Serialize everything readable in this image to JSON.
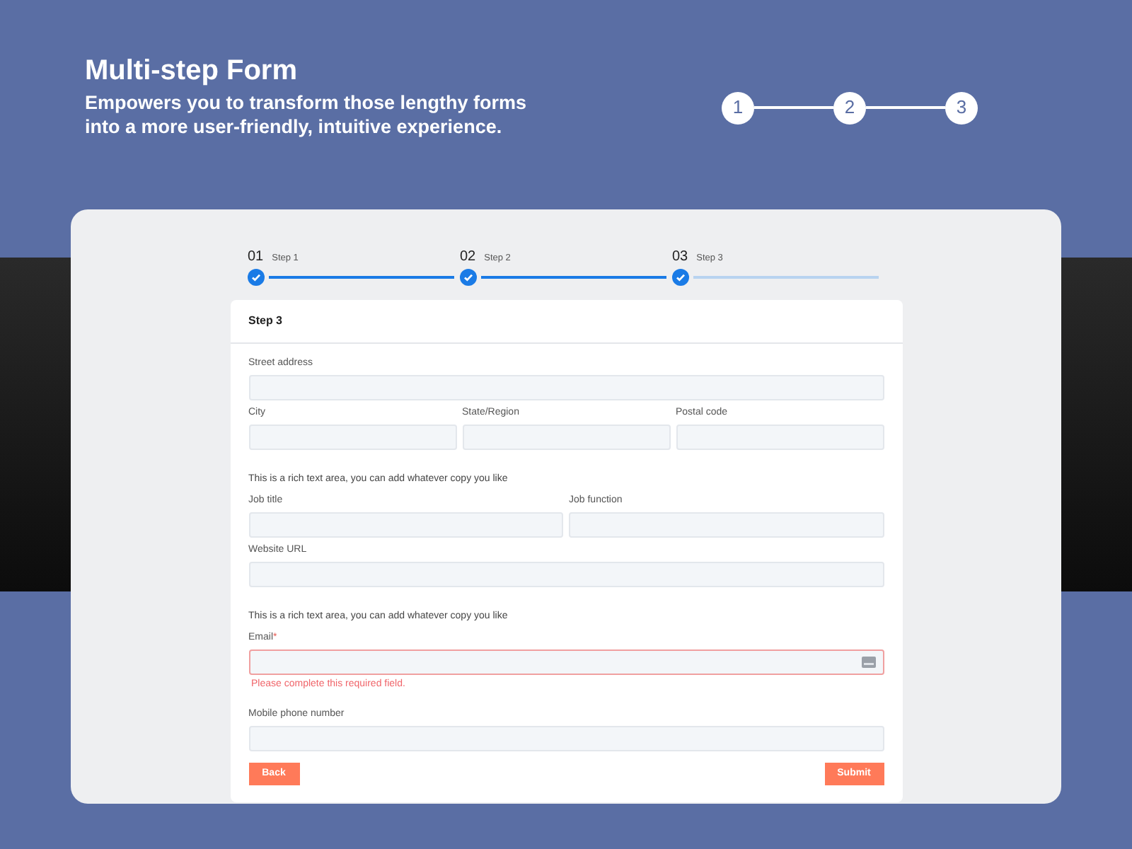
{
  "header": {
    "title": "Multi-step Form",
    "subtitle": "Empowers you to transform those lengthy forms into a more user-friendly, intuitive experience."
  },
  "mini_steps": [
    "1",
    "2",
    "3"
  ],
  "steps": [
    {
      "number": "01",
      "label": "Step 1",
      "completed": true,
      "line_done": true
    },
    {
      "number": "02",
      "label": "Step 2",
      "completed": true,
      "line_done": true
    },
    {
      "number": "03",
      "label": "Step 3",
      "completed": true,
      "line_done": false
    }
  ],
  "form": {
    "title": "Step 3",
    "rows": [
      {
        "kind": "fields",
        "fields": [
          {
            "label": "Street address"
          }
        ]
      },
      {
        "kind": "fields",
        "fields": [
          {
            "label": "City"
          },
          {
            "label": "State/Region"
          },
          {
            "label": "Postal code"
          }
        ]
      },
      {
        "kind": "text",
        "text": "This is a rich text area, you can add whatever copy you like"
      },
      {
        "kind": "fields",
        "fields": [
          {
            "label": "Job title"
          },
          {
            "label": "Job function"
          }
        ]
      },
      {
        "kind": "fields",
        "fields": [
          {
            "label": "Website URL"
          }
        ]
      },
      {
        "kind": "text",
        "text": "This is a rich text area, you can add whatever copy you like"
      },
      {
        "kind": "fields",
        "fields": [
          {
            "label": "Email",
            "required_mark": "*",
            "error": "Please complete this required field.",
            "has_icon": true
          }
        ]
      },
      {
        "kind": "fields",
        "fields": [
          {
            "label": "Mobile phone number"
          }
        ]
      }
    ],
    "back": "Back",
    "submit": "Submit"
  }
}
